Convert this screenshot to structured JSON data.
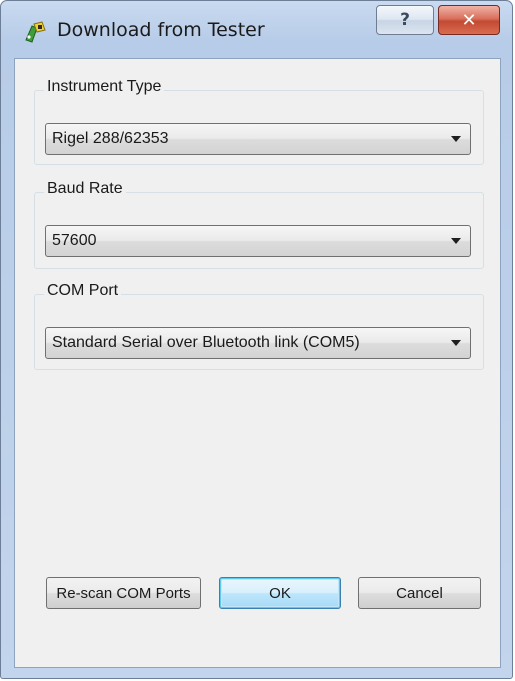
{
  "window": {
    "title": "Download from Tester",
    "help_label": "?",
    "close_label": "✕"
  },
  "groups": {
    "instrument_type": {
      "label": "Instrument Type",
      "value": "Rigel 288/62353"
    },
    "baud_rate": {
      "label": "Baud Rate",
      "value": "57600"
    },
    "com_port": {
      "label": "COM Port",
      "value": "Standard Serial over Bluetooth link (COM5)"
    }
  },
  "buttons": {
    "rescan": "Re-scan COM Ports",
    "ok": "OK",
    "cancel": "Cancel"
  },
  "colors": {
    "title_bar": "#c3d5ec",
    "dialog_body": "#f0f0f0",
    "close_button": "#c24a33",
    "default_button_border": "#3c7fb1"
  },
  "icons": {
    "app": "tester-app-icon",
    "dropdown": "chevron-down-icon"
  }
}
